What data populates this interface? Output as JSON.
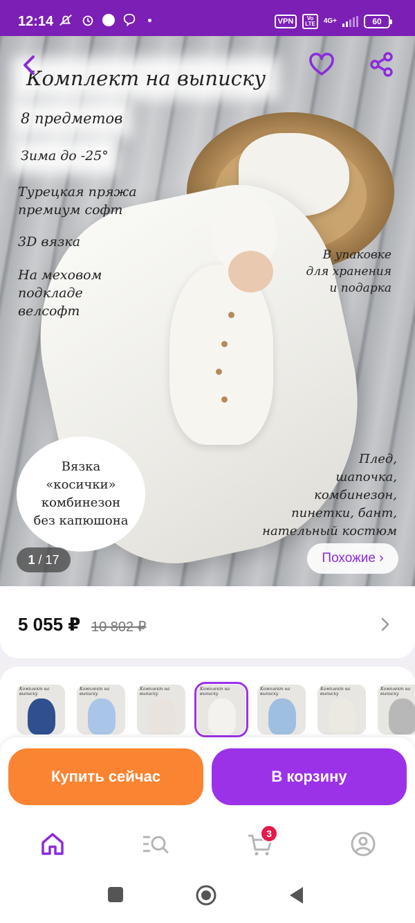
{
  "status_bar": {
    "time": "12:14",
    "vpn": "VPN",
    "volte": "Vo LTE",
    "network": "4G+",
    "battery": "60"
  },
  "product": {
    "title": "Комплект на выписку",
    "features_left": [
      "8 предметов",
      "Зима до -25°",
      "Турецкая пряжа\nпремиум софт",
      "3D вязка",
      "На меховом\nподкладе\nвелсофт"
    ],
    "note_right": "В упаковке\nдля хранения\nи подарка",
    "circle_note": "Вязка\n«косички»\nкомбинезон\nбез капюшона",
    "contents_note": "Плед,\nшапочка,\nкомбинезон,\nпинетки, бант,\nнательный костюм",
    "image_counter_current": "1",
    "image_counter_sep": " / ",
    "image_counter_total": "17",
    "similar_label": "Похожие ›"
  },
  "price": {
    "current": "5 055 ₽",
    "old": "10 802 ₽"
  },
  "thumbnails": [
    {
      "title": "Комплект на выписку",
      "color": "#2f4f8f",
      "selected": false
    },
    {
      "title": "Комплект на выписку",
      "color": "#a9c6e8",
      "selected": false
    },
    {
      "title": "Комплект на выписку",
      "color": "#e9e3dd",
      "selected": false
    },
    {
      "title": "Комплект на выписку",
      "color": "#f4f2ee",
      "selected": true
    },
    {
      "title": "Комплект на выписку",
      "color": "#9fbfe0",
      "selected": false
    },
    {
      "title": "Комплект на выписку",
      "color": "#ece8e2",
      "selected": false
    },
    {
      "title": "Комплект на выписку",
      "color": "#b8b8b8",
      "selected": false
    }
  ],
  "actions": {
    "buy_now": "Купить сейчас",
    "add_to_cart": "В корзину"
  },
  "bottom_nav": {
    "cart_badge": "3",
    "items": [
      "home-icon",
      "catalog-search-icon",
      "cart-icon",
      "profile-icon"
    ]
  },
  "colors": {
    "brand": "#7b1fb5",
    "accent_purple": "#9b32e8",
    "accent_orange": "#fb8432",
    "badge": "#e6194b"
  }
}
